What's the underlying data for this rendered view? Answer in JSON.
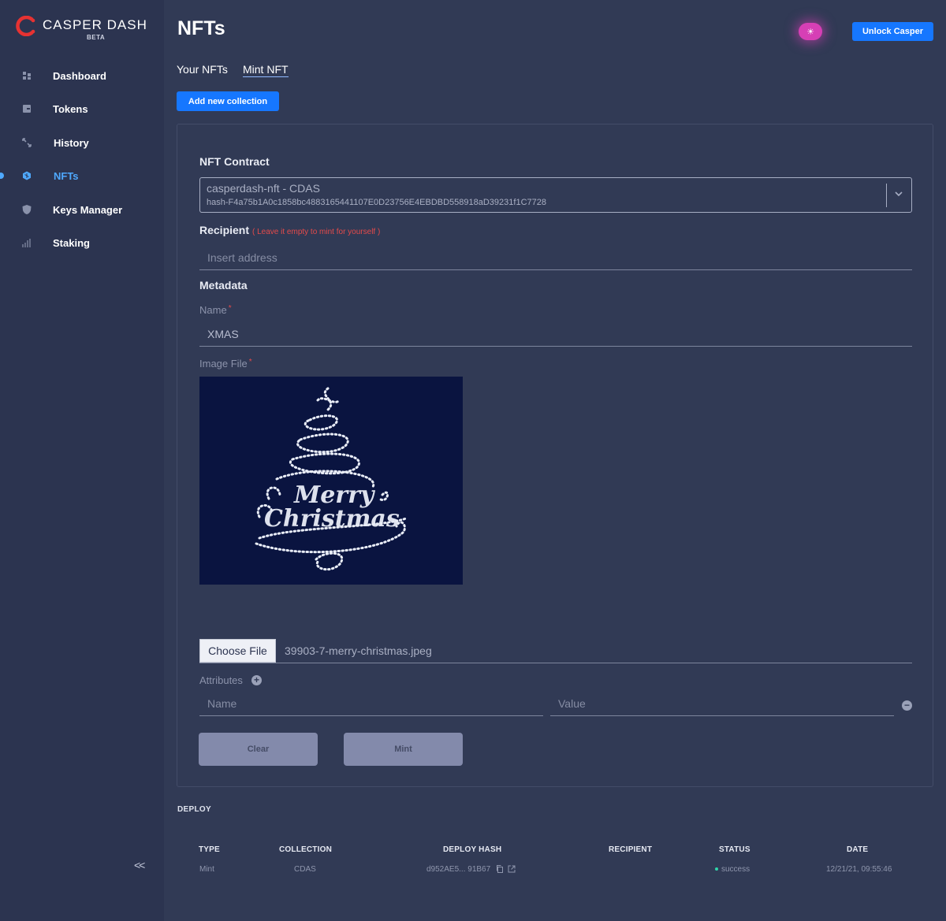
{
  "app": {
    "logo_text": "CASPER DASH",
    "beta_label": "BETA",
    "brand_color": "#e63232",
    "accent_color": "#1677ff"
  },
  "sidebar": {
    "items": [
      {
        "label": "Dashboard",
        "icon": "grid-icon",
        "active": false
      },
      {
        "label": "Tokens",
        "icon": "wallet-icon",
        "active": false
      },
      {
        "label": "History",
        "icon": "arrows-icon",
        "active": false
      },
      {
        "label": "NFTs",
        "icon": "hexagon-icon",
        "active": true
      },
      {
        "label": "Keys Manager",
        "icon": "shield-icon",
        "active": false
      },
      {
        "label": "Staking",
        "icon": "bar-chart-icon",
        "active": false
      }
    ],
    "collapse_label": "<<"
  },
  "header": {
    "title": "NFTs",
    "unlock_label": "Unlock Casper",
    "theme_icon": "sun-icon"
  },
  "tabs": [
    {
      "label": "Your NFTs",
      "active": false
    },
    {
      "label": "Mint NFT",
      "active": true
    }
  ],
  "add_collection_label": "Add new collection",
  "form": {
    "contract_label": "NFT Contract",
    "contract_selected": "casperdash-nft - CDAS",
    "contract_hash": "hash-F4a75b1A0c1858bc4883165441107E0D23756E4EBDBD558918aD39231f1C7728",
    "recipient_label": "Recipient",
    "recipient_hint": "( Leave it empty to mint for yourself )",
    "recipient_placeholder": "Insert address",
    "metadata_label": "Metadata",
    "name_label": "Name",
    "name_value": "XMAS",
    "image_label": "Image File",
    "required_mark": "*",
    "choose_file_label": "Choose File",
    "file_name": "39903-7-merry-christmas.jpeg",
    "attributes_label": "Attributes",
    "attr_name_placeholder": "Name",
    "attr_value_placeholder": "Value",
    "clear_label": "Clear",
    "mint_label": "Mint"
  },
  "deploy": {
    "title": "DEPLOY",
    "columns": [
      "TYPE",
      "COLLECTION",
      "DEPLOY HASH",
      "RECIPIENT",
      "STATUS",
      "DATE"
    ],
    "rows": [
      {
        "type": "Mint",
        "collection": "CDAS",
        "deploy_hash": "d952AE5... 91B67",
        "recipient": "",
        "status": "success",
        "date": "12/21/21, 09:55:46"
      }
    ],
    "status_color": "#2fd5a8"
  }
}
